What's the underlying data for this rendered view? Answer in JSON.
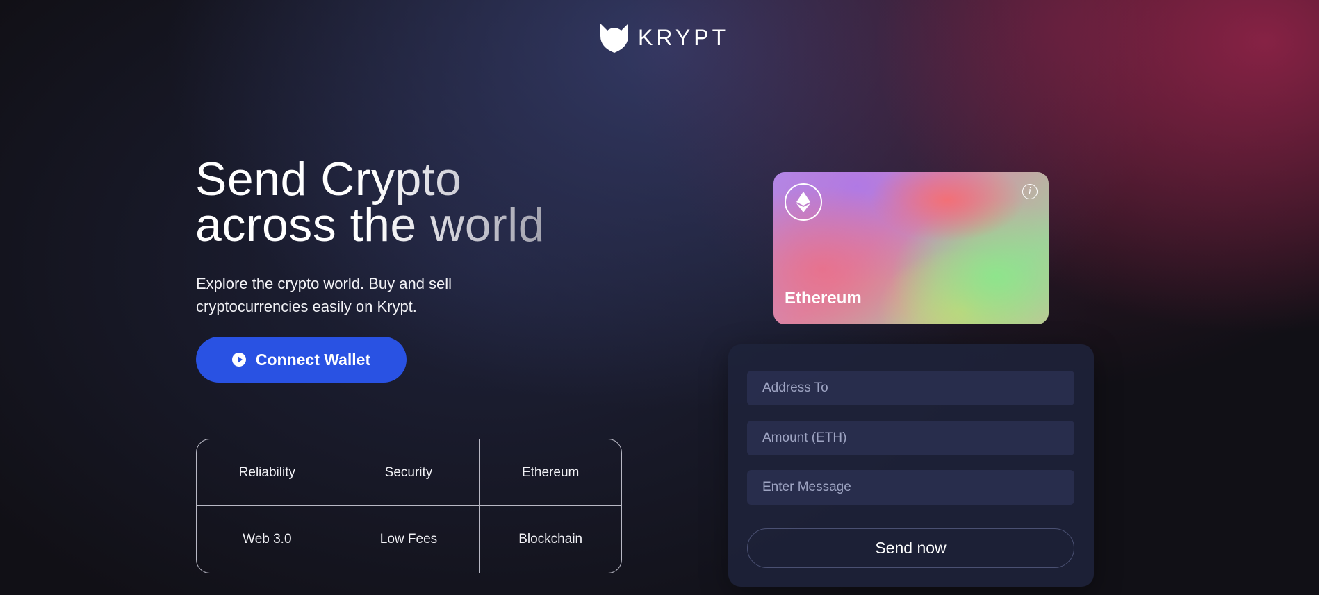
{
  "header": {
    "brand": "KRYPT",
    "logo_icon": "fox-logo-icon"
  },
  "hero": {
    "title_line1": "Send Crypto",
    "title_line2": "across the world",
    "subtitle": "Explore the crypto world. Buy and sell cryptocurrencies easily on Krypt.",
    "connect_label": "Connect Wallet",
    "connect_color": "#2952e3"
  },
  "features": [
    "Reliability",
    "Security",
    "Ethereum",
    "Web 3.0",
    "Low Fees",
    "Blockchain"
  ],
  "card": {
    "network": "Ethereum",
    "coin_icon": "ethereum-icon",
    "info_icon": "info-icon"
  },
  "form": {
    "address_placeholder": "Address To",
    "amount_placeholder": "Amount (ETH)",
    "message_placeholder": "Enter Message",
    "submit_label": "Send now"
  }
}
